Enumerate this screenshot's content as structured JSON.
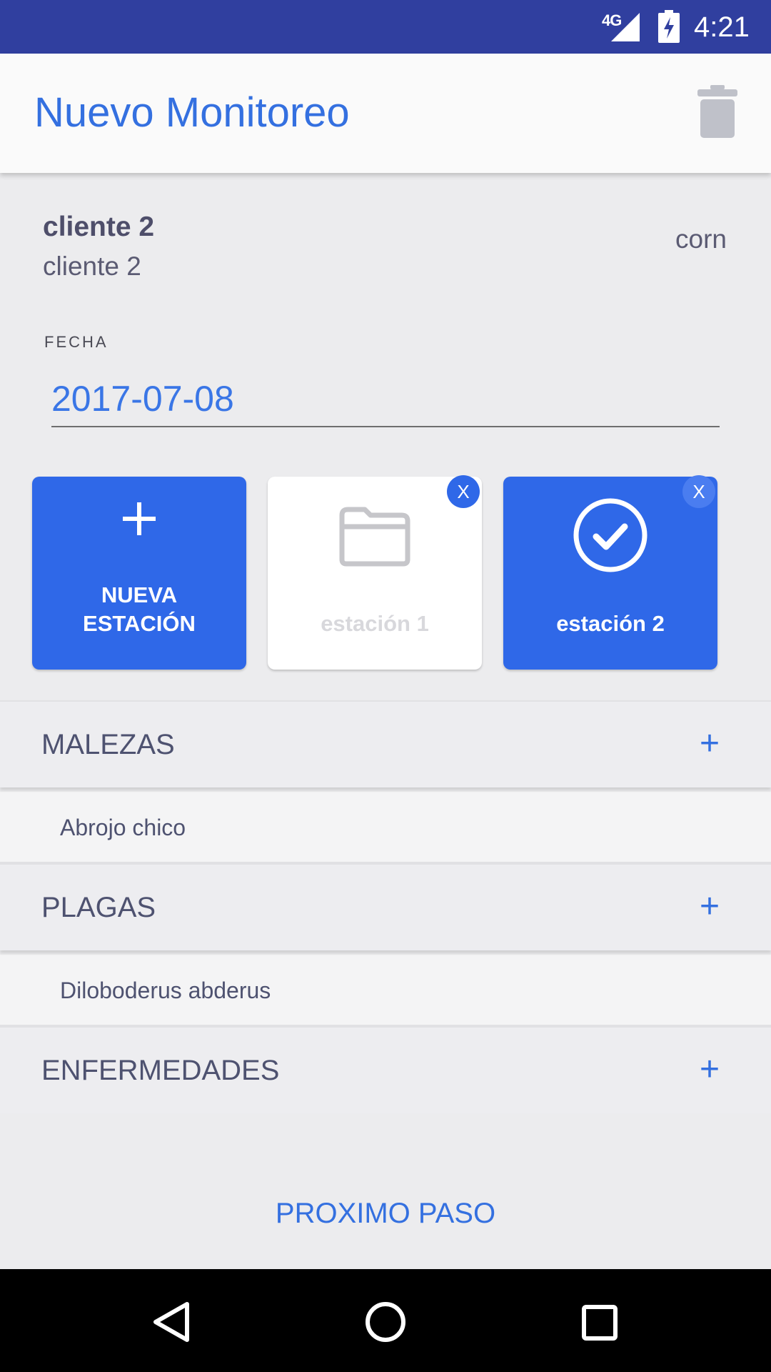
{
  "status_bar": {
    "network": "4G",
    "time": "4:21"
  },
  "app_bar": {
    "title": "Nuevo Monitoreo",
    "delete_icon": "trash-icon"
  },
  "client": {
    "name": "cliente 2",
    "subtitle": "cliente 2",
    "crop": "corn"
  },
  "date": {
    "label": "FECHA",
    "value": "2017-07-08"
  },
  "stations": {
    "new": {
      "label_line1": "NUEVA",
      "label_line2": "ESTACIÓN",
      "icon": "plus-icon"
    },
    "items": [
      {
        "label": "estación 1",
        "icon": "folder-icon",
        "close": "X",
        "selected": false
      },
      {
        "label": "estación 2",
        "icon": "check-circle-icon",
        "close": "X",
        "selected": true
      }
    ]
  },
  "sections": [
    {
      "title": "MALEZAS",
      "add": "+",
      "items": [
        "Abrojo chico"
      ]
    },
    {
      "title": "PLAGAS",
      "add": "+",
      "items": [
        "Diloboderus abderus"
      ]
    },
    {
      "title": "ENFERMEDADES",
      "add": "+",
      "items": []
    }
  ],
  "footer": {
    "next_label": "PROXIMO PASO"
  },
  "colors": {
    "primary": "#3470e0",
    "card_blue": "#2f68e8",
    "status_bar": "#303f9f"
  }
}
